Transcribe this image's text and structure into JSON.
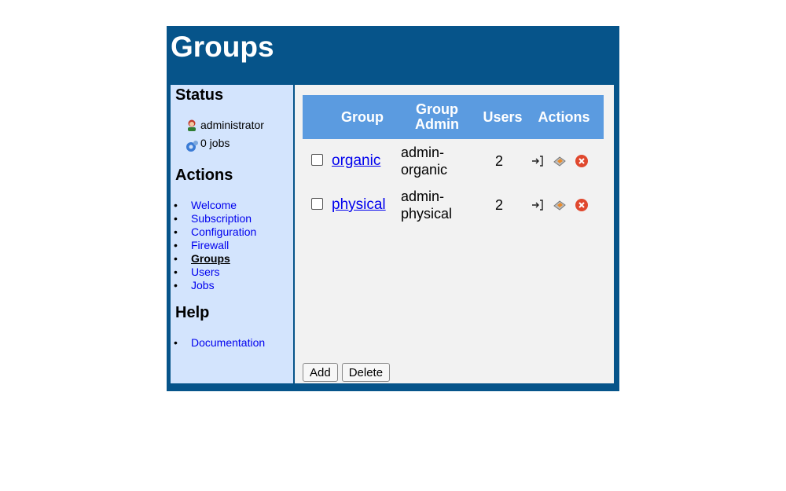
{
  "page": {
    "title": "Groups"
  },
  "sidebar": {
    "status_heading": "Status",
    "status_user": "administrator",
    "status_jobs": "0 jobs",
    "actions_heading": "Actions",
    "nav": [
      {
        "label": "Welcome",
        "active": false
      },
      {
        "label": "Subscription",
        "active": false
      },
      {
        "label": "Configuration",
        "active": false
      },
      {
        "label": "Firewall",
        "active": false
      },
      {
        "label": "Groups",
        "active": true
      },
      {
        "label": "Users",
        "active": false
      },
      {
        "label": "Jobs",
        "active": false
      }
    ],
    "help_heading": "Help",
    "help_links": [
      {
        "label": "Documentation"
      }
    ]
  },
  "table": {
    "headers": {
      "group": "Group",
      "group_admin_line1": "Group",
      "group_admin_line2": "Admin",
      "users": "Users",
      "actions": "Actions"
    },
    "rows": [
      {
        "group": "organic",
        "admin_line1": "admin-",
        "admin_line2": "organic",
        "users": "2",
        "checked": false
      },
      {
        "group": "physical",
        "admin_line1": "admin-",
        "admin_line2": "physical",
        "users": "2",
        "checked": false
      }
    ],
    "action_icons": [
      "login-icon",
      "edit-icon",
      "delete-icon"
    ]
  },
  "buttons": {
    "add": "Add",
    "delete": "Delete"
  },
  "colors": {
    "header_bar": "#06548a",
    "sidebar_bg": "#d3e4fd",
    "table_header": "#5b9be0",
    "main_bg": "#f2f2f2",
    "delete_red": "#e0482e"
  }
}
